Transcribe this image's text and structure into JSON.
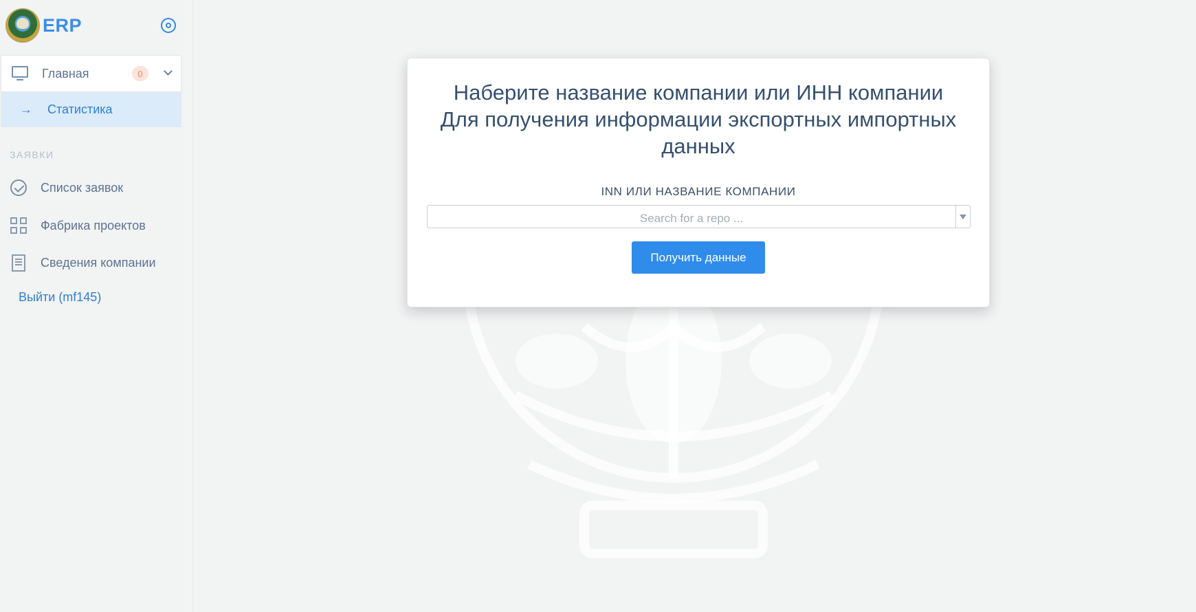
{
  "brand": {
    "name": "ERP"
  },
  "sidebar": {
    "main_item": {
      "label": "Главная",
      "badge": "0"
    },
    "sub_item": {
      "label": "Статистика"
    },
    "section_title": "ЗАЯВКИ",
    "items": [
      {
        "label": "Список заявок",
        "icon": "check-circle-icon"
      },
      {
        "label": "Фабрика проектов",
        "icon": "grid-icon"
      },
      {
        "label": "Сведения компании",
        "icon": "document-icon"
      }
    ],
    "logout_label": "Выйти (mf145)"
  },
  "main": {
    "title_line1": "Наберите название компании или ИНН компании",
    "title_line2": "Для получения информации экспортных импортных данных",
    "field_label": "INN ИЛИ НАЗВАНИЕ КОМПАНИИ",
    "search": {
      "value": "",
      "placeholder": "Search for a repo ..."
    },
    "submit_label": "Получить данные"
  },
  "colors": {
    "accent": "#2f8ceb",
    "badge_bg": "#fde3da",
    "badge_text": "#f08a68",
    "active_bg": "#dcebfa"
  }
}
